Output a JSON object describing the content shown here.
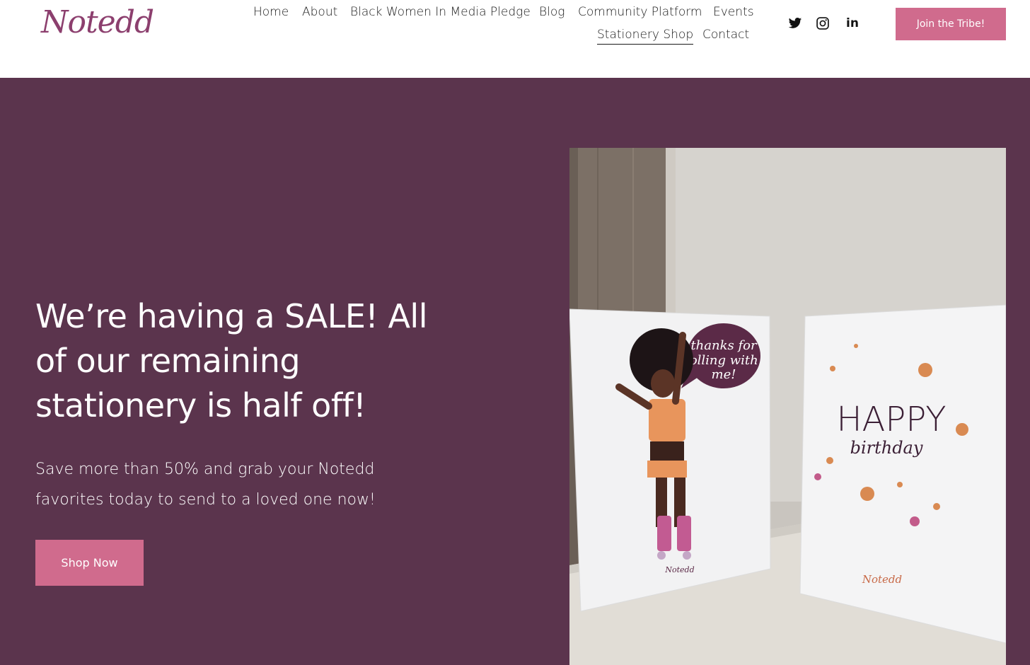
{
  "header": {
    "logo": "Notedd",
    "nav": [
      {
        "label": "Home",
        "active": false
      },
      {
        "label": "About",
        "active": false
      },
      {
        "label": "Black Women In Media Pledge",
        "active": false
      },
      {
        "label": "Blog",
        "active": false
      },
      {
        "label": "Community Platform",
        "active": false
      },
      {
        "label": "Events",
        "active": false
      },
      {
        "label": "Stationery Shop",
        "active": true
      },
      {
        "label": "Contact",
        "active": false
      }
    ],
    "social": [
      {
        "icon": "twitter-icon"
      },
      {
        "icon": "instagram-icon"
      },
      {
        "icon": "linkedin-icon",
        "text": "in"
      }
    ],
    "cta_label": "Join the Tribe!"
  },
  "hero": {
    "headline": "We’re having a SALE! All of our remaining stationery is half off!",
    "subtext": "Save more than 50% and grab your Notedd favorites today to send to a loved one now!",
    "button_label": "Shop Now",
    "image": {
      "card_left": {
        "speech_bubble": [
          "thanks for",
          "rolling with",
          "me!"
        ],
        "logo": "Notedd"
      },
      "card_right": {
        "title": "HAPPY",
        "subtitle": "birthday",
        "logo": "Notedd"
      }
    }
  },
  "colors": {
    "brand": "#8c3f6e",
    "accent": "#d06b8d",
    "hero_bg": "#5b344d",
    "text": "#1a1a1a"
  }
}
